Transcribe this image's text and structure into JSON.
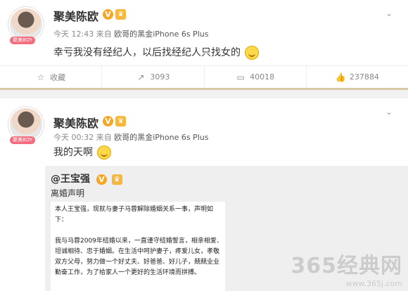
{
  "post1": {
    "username": "聚美陈欧",
    "avatar_badge": "聚美BOY",
    "time": "今天 12:43",
    "source_prefix": "来自",
    "source": "欧哥的黑金iPhone 6s Plus",
    "content": "幸亏我没有经纪人，以后找经纪人只找女的",
    "actions": {
      "favorite": "收藏",
      "repost": "3093",
      "comment": "40018",
      "like": "237884"
    }
  },
  "post2": {
    "username": "聚美陈欧",
    "avatar_badge": "聚美BOY",
    "time": "今天 00:32",
    "source_prefix": "来自",
    "source": "欧哥的黑金iPhone 6s Plus",
    "content": "我的天啊",
    "repost": {
      "user": "@王宝强",
      "title": "离婚声明",
      "doc_lines": [
        "本人王宝强，现就与妻子马蓉解除婚姻关系一事，声明如",
        "下：",
        "",
        "我与马蓉2009年结婚以来，一直谨守结婚誓言，相亲相爱、",
        "坦诚相待、忠于婚姻。在生活中呵护妻子，疼爱儿女，孝敬",
        "双方父母，努力做一个好丈夫、好爸爸、好儿子，兢兢业业",
        "勤奋工作，为了给家人一个更好的生活环境而拼搏。"
      ]
    }
  },
  "watermark": {
    "main": "365经典网",
    "sub": "www.365j.com"
  },
  "icons": {
    "verified": "verified-v-icon",
    "member": "member-crown-icon",
    "chevron": "chevron-down-icon",
    "favorite": "star-icon",
    "repost": "repost-arrow-icon",
    "comment": "comment-icon",
    "like": "thumbs-up-icon"
  }
}
